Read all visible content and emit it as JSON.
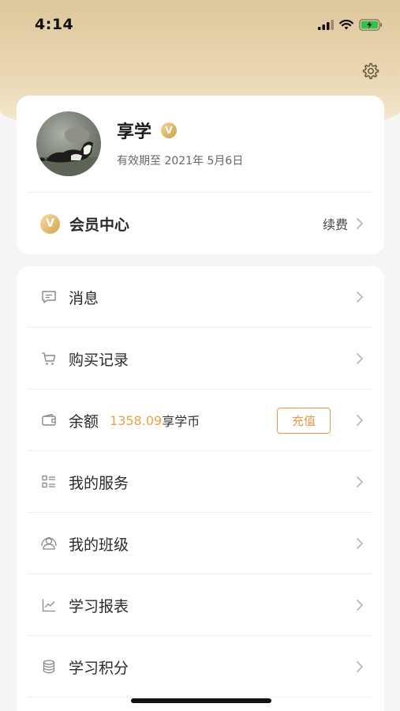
{
  "status_bar": {
    "time": "4:14"
  },
  "profile": {
    "username": "享学",
    "vip_badge": "V",
    "validity": "有效期至 2021年 5月6日"
  },
  "member": {
    "badge": "V",
    "label": "会员中心",
    "renew": "续费"
  },
  "menu": {
    "messages": "消息",
    "purchases": "购买记录",
    "balance_label": "余额",
    "balance_amount": "1358.09",
    "balance_unit": "享学币",
    "recharge": "充值",
    "services": "我的服务",
    "classes": "我的班级",
    "reports": "学习报表",
    "points": "学习积分"
  },
  "colors": {
    "accent": "#e09a4a",
    "hero_gold": "#ddc79c",
    "amount": "#e8a14a"
  },
  "icons": [
    "gear-icon",
    "message-icon",
    "cart-icon",
    "wallet-icon",
    "services-icon",
    "class-icon",
    "chart-icon",
    "coins-icon",
    "chevron-right-icon"
  ]
}
